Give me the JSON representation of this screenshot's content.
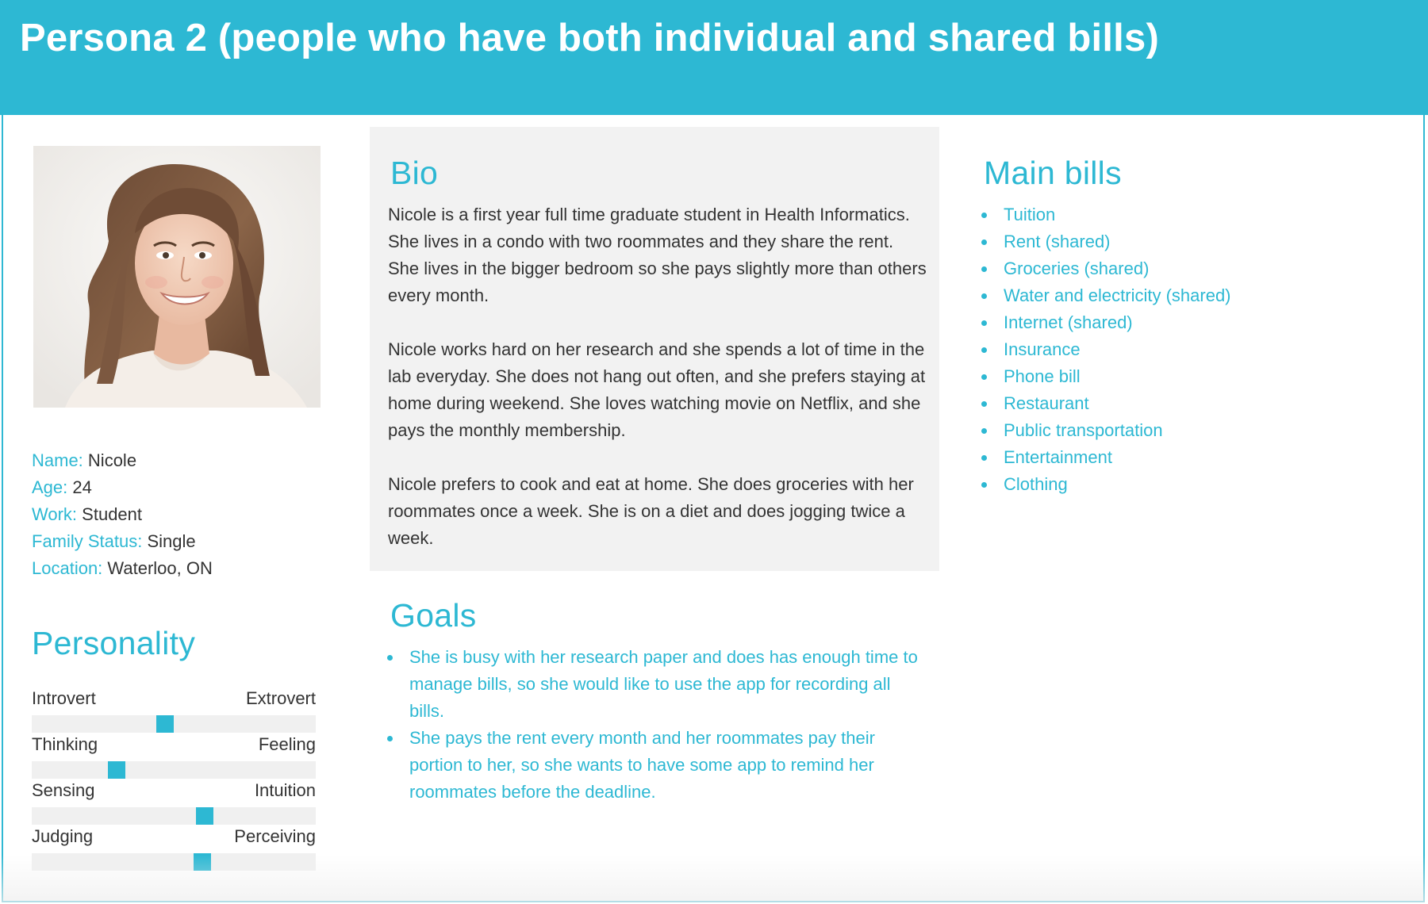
{
  "header": {
    "title": "Persona 2 (people who have both individual and shared bills)"
  },
  "profile": {
    "photo_alt": "Nicole",
    "facts": [
      {
        "key": "Name:",
        "value": "Nicole"
      },
      {
        "key": "Age:",
        "value": "24"
      },
      {
        "key": "Work:",
        "value": "Student"
      },
      {
        "key": "Family Status:",
        "value": "Single"
      },
      {
        "key": "Location:",
        "value": "Waterloo, ON"
      }
    ]
  },
  "personality": {
    "heading": "Personality",
    "traits": [
      {
        "left": "Introvert",
        "right": "Extrovert",
        "level": 0.47
      },
      {
        "left": "Thinking",
        "right": "Feeling",
        "level": 0.3
      },
      {
        "left": "Sensing",
        "right": "Intuition",
        "level": 0.61
      },
      {
        "left": "Judging",
        "right": "Perceiving",
        "level": 0.6
      }
    ]
  },
  "bio": {
    "heading": "Bio",
    "paragraphs": [
      "Nicole is a first year full time graduate student in Health Informatics. She lives in a condo with two roommates and they share the rent. She lives in the bigger bedroom so she pays slightly more than others every month.",
      "Nicole works hard on her research and she spends a lot of time in the lab everyday. She does not hang out often, and she prefers staying at home during weekend. She loves watching movie on Netflix, and she pays the monthly membership.",
      "Nicole prefers to cook and eat at home. She does groceries with her roommates once a week. She is on a diet and does jogging twice a week."
    ]
  },
  "goals": {
    "heading": "Goals",
    "items": [
      "She is busy with her research paper and does has enough time to manage bills, so she would like to use the app for recording all bills.",
      "She pays the rent every month and her roommates pay their portion to her, so she wants to have some app to remind her roommates before the deadline."
    ]
  },
  "bills": {
    "heading": "Main bills",
    "items": [
      "Tuition",
      "Rent (shared)",
      "Groceries (shared)",
      "Water and electricity (shared)",
      "Internet (shared)",
      "Insurance",
      "Phone bill",
      "Restaurant",
      "Public transportation",
      "Entertainment",
      "Clothing"
    ]
  },
  "colors": {
    "accent": "#2db8d3",
    "text": "#333333",
    "panel": "#f2f2f2",
    "track": "#f0f0f0"
  }
}
